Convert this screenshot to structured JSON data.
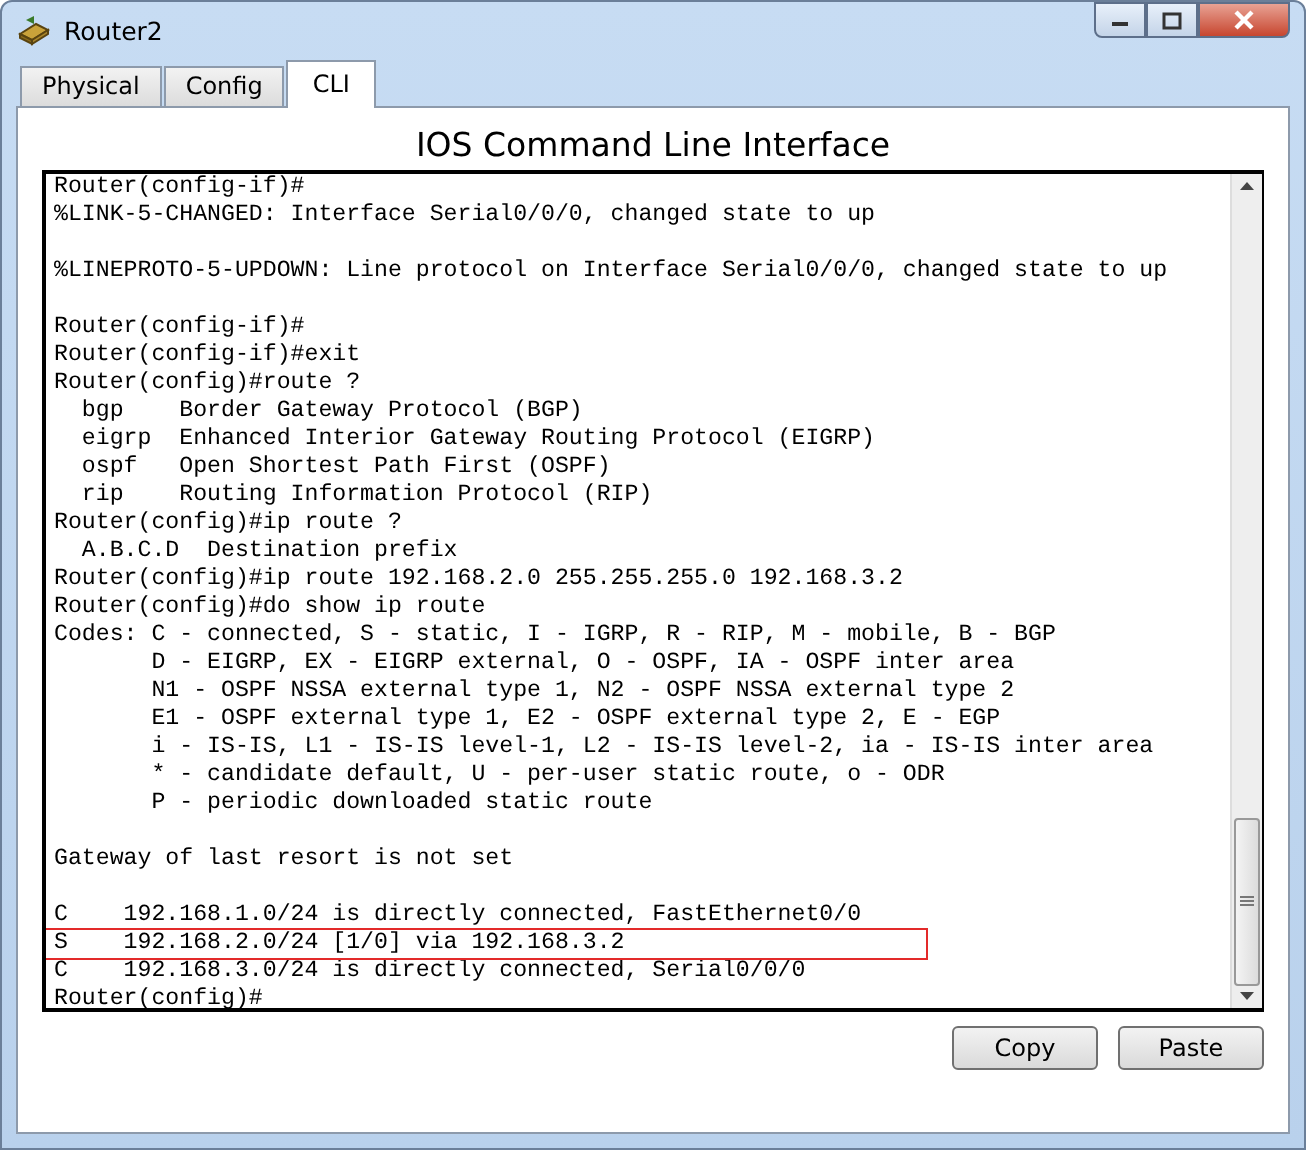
{
  "window": {
    "title": "Router2"
  },
  "tabs": [
    {
      "label": "Physical",
      "selected": false
    },
    {
      "label": "Config",
      "selected": false
    },
    {
      "label": "CLI",
      "selected": true
    }
  ],
  "heading": "IOS Command Line Interface",
  "terminal": {
    "lines": [
      {
        "kind": "text",
        "text": "Router(config-if)#",
        "highlighted": false
      },
      {
        "kind": "text",
        "text": "%LINK-5-CHANGED: Interface Serial0/0/0, changed state to up",
        "highlighted": false
      },
      {
        "kind": "blank"
      },
      {
        "kind": "text",
        "text": "%LINEPROTO-5-UPDOWN: Line protocol on Interface Serial0/0/0, changed state to up",
        "highlighted": false
      },
      {
        "kind": "blank"
      },
      {
        "kind": "text",
        "text": "Router(config-if)#",
        "highlighted": false
      },
      {
        "kind": "text",
        "text": "Router(config-if)#exit",
        "highlighted": false
      },
      {
        "kind": "text",
        "text": "Router(config)#route ?",
        "highlighted": false
      },
      {
        "kind": "text",
        "text": "  bgp    Border Gateway Protocol (BGP)",
        "highlighted": false
      },
      {
        "kind": "text",
        "text": "  eigrp  Enhanced Interior Gateway Routing Protocol (EIGRP)",
        "highlighted": false
      },
      {
        "kind": "text",
        "text": "  ospf   Open Shortest Path First (OSPF)",
        "highlighted": false
      },
      {
        "kind": "text",
        "text": "  rip    Routing Information Protocol (RIP)",
        "highlighted": false
      },
      {
        "kind": "text",
        "text": "Router(config)#ip route ?",
        "highlighted": false
      },
      {
        "kind": "text",
        "text": "  A.B.C.D  Destination prefix",
        "highlighted": false
      },
      {
        "kind": "text",
        "text": "Router(config)#ip route 192.168.2.0 255.255.255.0 192.168.3.2",
        "highlighted": false
      },
      {
        "kind": "text",
        "text": "Router(config)#do show ip route",
        "highlighted": false
      },
      {
        "kind": "text",
        "text": "Codes: C - connected, S - static, I - IGRP, R - RIP, M - mobile, B - BGP",
        "highlighted": false
      },
      {
        "kind": "text",
        "text": "       D - EIGRP, EX - EIGRP external, O - OSPF, IA - OSPF inter area",
        "highlighted": false
      },
      {
        "kind": "text",
        "text": "       N1 - OSPF NSSA external type 1, N2 - OSPF NSSA external type 2",
        "highlighted": false
      },
      {
        "kind": "text",
        "text": "       E1 - OSPF external type 1, E2 - OSPF external type 2, E - EGP",
        "highlighted": false
      },
      {
        "kind": "text",
        "text": "       i - IS-IS, L1 - IS-IS level-1, L2 - IS-IS level-2, ia - IS-IS inter area",
        "highlighted": false
      },
      {
        "kind": "text",
        "text": "       * - candidate default, U - per-user static route, o - ODR",
        "highlighted": false
      },
      {
        "kind": "text",
        "text": "       P - periodic downloaded static route",
        "highlighted": false
      },
      {
        "kind": "blank"
      },
      {
        "kind": "text",
        "text": "Gateway of last resort is not set",
        "highlighted": false
      },
      {
        "kind": "blank"
      },
      {
        "kind": "text",
        "text": "C    192.168.1.0/24 is directly connected, FastEthernet0/0",
        "highlighted": false
      },
      {
        "kind": "text",
        "text": "S    192.168.2.0/24 [1/0] via 192.168.3.2",
        "highlighted": true
      },
      {
        "kind": "text",
        "text": "C    192.168.3.0/24 is directly connected, Serial0/0/0",
        "highlighted": false
      },
      {
        "kind": "text",
        "text": "Router(config)#",
        "highlighted": false
      }
    ]
  },
  "buttons": [
    "Copy",
    "Paste"
  ]
}
